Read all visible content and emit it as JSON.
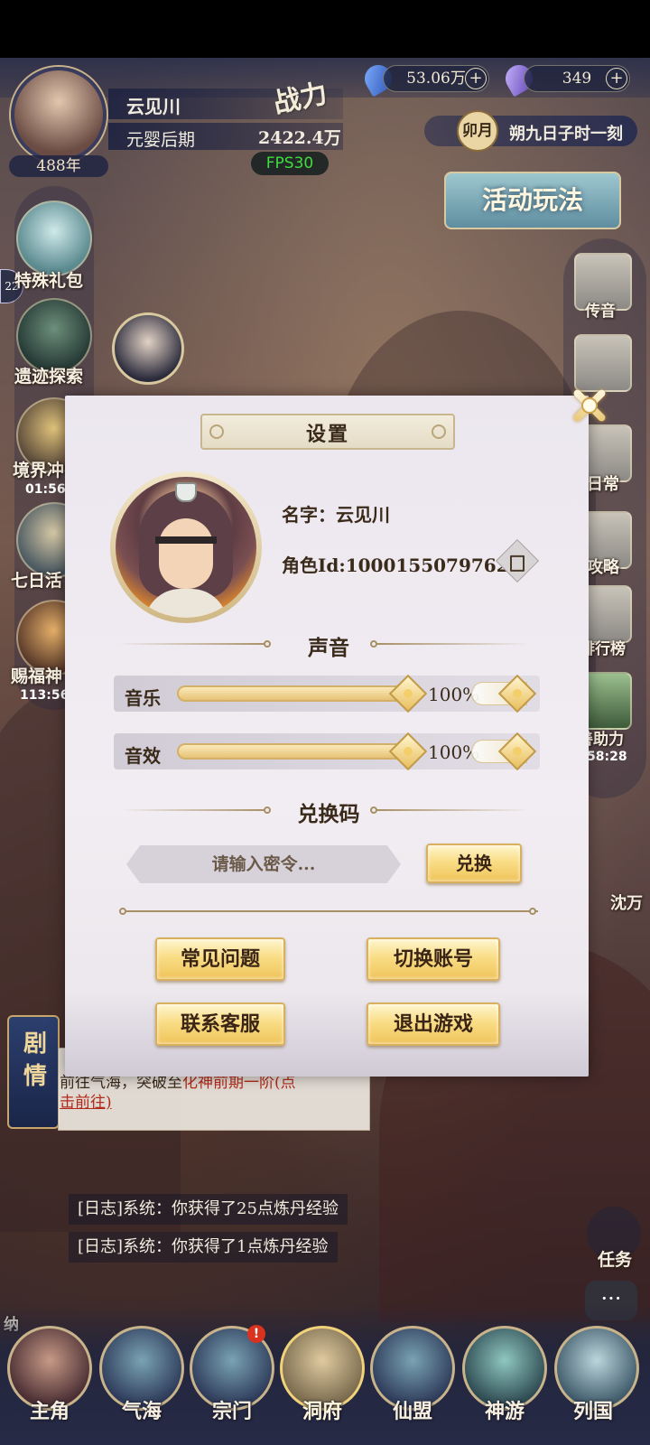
{
  "player": {
    "name": "云见川",
    "realm": "元婴后期",
    "age": "488年",
    "combat_label": "战力",
    "combat_power": "2422.4万",
    "fps": "FPS30"
  },
  "resources": {
    "spirit_stones": "53.06万",
    "jade": "349",
    "plus": "+"
  },
  "calendar": {
    "badge": "卯月",
    "date": "朔九日子时一刻"
  },
  "event_banner": "活动玩法",
  "left_menu": [
    {
      "label": "特殊礼包"
    },
    {
      "label": "遗迹探索"
    },
    {
      "label": "境界冲",
      "timer": "01:56"
    },
    {
      "label": "七日活"
    },
    {
      "label": "赐福神",
      "timer": "113:56"
    }
  ],
  "right_menu": [
    {
      "label": "传音"
    },
    {
      "label": "日常"
    },
    {
      "label": "攻略"
    },
    {
      "label": "排行榜"
    },
    {
      "label": "善助力",
      "timer": "58:28"
    }
  ],
  "side_badge": "22",
  "npc_name": "沈万",
  "story": {
    "tag": "剧情",
    "line1_a": "前往气海，突破至",
    "line1_b": "化神前期一阶(点",
    "line2": "击前往)"
  },
  "logs": [
    "[日志]系统：你获得了25点炼丹经验",
    "[日志]系统：你获得了1点炼丹经验"
  ],
  "task_label": "任务",
  "chat_icon": "···",
  "collect_label": "纳",
  "bottom_nav": [
    {
      "label": "主角",
      "active": false
    },
    {
      "label": "气海",
      "active": false
    },
    {
      "label": "宗门",
      "active": false,
      "badge": "!"
    },
    {
      "label": "洞府",
      "active": true
    },
    {
      "label": "仙盟",
      "active": false
    },
    {
      "label": "神游",
      "active": false
    },
    {
      "label": "列国",
      "active": false
    }
  ],
  "settings": {
    "title": "设置",
    "name_line": "名字：云见川",
    "role_id_line": "角色Id:10001550797624",
    "sound_header": "声音",
    "music_label": "音乐",
    "music_value": "100%",
    "music_level": 1.0,
    "sfx_label": "音效",
    "sfx_value": "100%",
    "sfx_level": 1.0,
    "redeem_header": "兑换码",
    "redeem_placeholder": "请输入密令...",
    "redeem_button": "兑换",
    "buttons": {
      "faq": "常见问题",
      "switch_account": "切换账号",
      "contact": "联系客服",
      "exit": "退出游戏"
    }
  },
  "colors": {
    "panel_bg": "#ece7ef",
    "gold_button": "#f9dd86",
    "hud_navy": "#262a46",
    "fps_green": "#3fdc3f",
    "story_red": "#b22a1a"
  }
}
